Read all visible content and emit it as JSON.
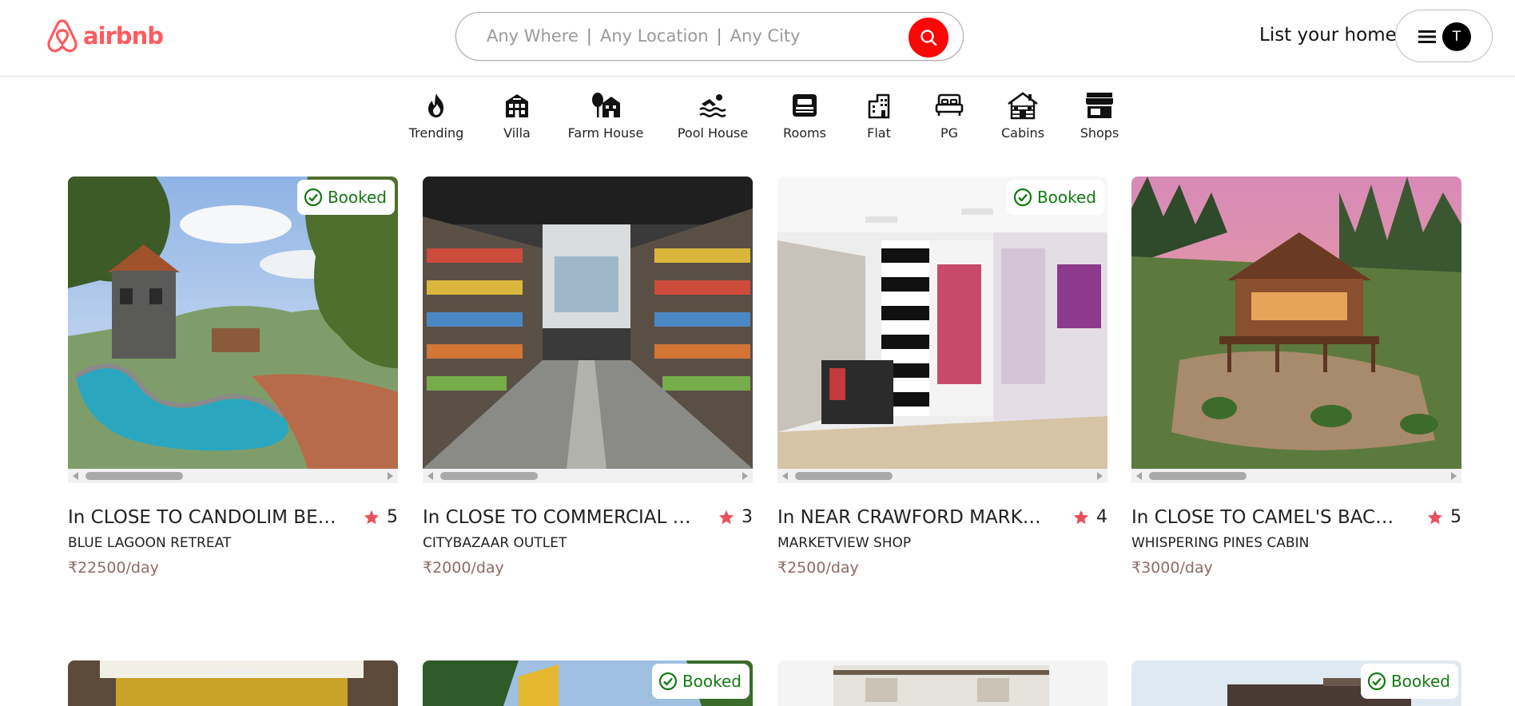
{
  "header": {
    "logo_text": "airbnb",
    "search": {
      "where": "Any Where",
      "location": "Any Location",
      "city": "Any City",
      "separator": "|"
    },
    "list_home_label": "List your home",
    "avatar_initial": "T"
  },
  "categories": [
    {
      "label": "Trending",
      "icon": "fire-icon"
    },
    {
      "label": "Villa",
      "icon": "villa-icon"
    },
    {
      "label": "Farm House",
      "icon": "farmhouse-icon"
    },
    {
      "label": "Pool House",
      "icon": "pool-icon"
    },
    {
      "label": "Rooms",
      "icon": "bed-icon"
    },
    {
      "label": "Flat",
      "icon": "building-icon"
    },
    {
      "label": "PG",
      "icon": "bed-outline-icon"
    },
    {
      "label": "Cabins",
      "icon": "cabin-icon"
    },
    {
      "label": "Shops",
      "icon": "shop-icon"
    }
  ],
  "booked_label": "Booked",
  "listings": [
    {
      "title": "In CLOSE TO CANDOLIM BEACH",
      "rating": "5",
      "name": "BLUE LAGOON RETREAT",
      "price": "₹22500/day",
      "booked": true
    },
    {
      "title": "In CLOSE TO COMMERCIAL STREET",
      "rating": "3",
      "name": "CITYBAZAAR OUTLET",
      "price": "₹2000/day",
      "booked": false
    },
    {
      "title": "In NEAR CRAWFORD MARKET, MUMBAI",
      "rating": "4",
      "name": "MARKETVIEW SHOP",
      "price": "₹2500/day",
      "booked": true
    },
    {
      "title": "In CLOSE TO CAMEL'S BACK ROAD",
      "rating": "5",
      "name": "WHISPERING PINES CABIN",
      "price": "₹3000/day",
      "booked": false
    }
  ],
  "lower_listings": [
    {
      "booked": false
    },
    {
      "booked": true
    },
    {
      "booked": false
    },
    {
      "booked": true
    }
  ],
  "colors": {
    "brand": "#ff5a5f",
    "search_button": "#ff0505",
    "booked_text": "#127a12",
    "star": "#e8505b",
    "price": "#8e6a6a"
  }
}
